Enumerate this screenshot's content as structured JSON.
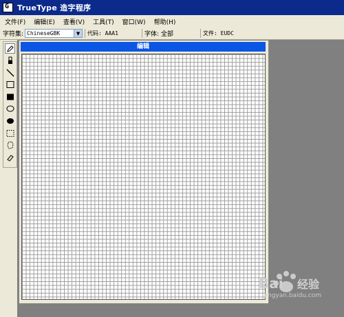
{
  "window": {
    "title": "TrueType 造字程序"
  },
  "menu": [
    {
      "label": "文件(F)"
    },
    {
      "label": "编辑(E)"
    },
    {
      "label": "查看(V)"
    },
    {
      "label": "工具(T)"
    },
    {
      "label": "窗口(W)"
    },
    {
      "label": "帮助(H)"
    }
  ],
  "toolbar": {
    "charset_label": "字符集:",
    "charset_value": "ChineseGBK",
    "code_label": "代码: AAA1",
    "font_label": "字体: 全部",
    "file_label": "文件: EUDC"
  },
  "tools": [
    {
      "name": "pencil-icon"
    },
    {
      "name": "brush-icon"
    },
    {
      "name": "line-icon"
    },
    {
      "name": "hollow-rectangle-icon"
    },
    {
      "name": "filled-rectangle-icon"
    },
    {
      "name": "hollow-ellipse-icon"
    },
    {
      "name": "filled-ellipse-icon"
    },
    {
      "name": "rectangular-select-icon"
    },
    {
      "name": "freeform-select-icon"
    },
    {
      "name": "eraser-icon"
    }
  ],
  "editor": {
    "title": "编辑"
  },
  "watermark": {
    "brand": "Bai 经验",
    "url": "jingyan.baidu.com"
  },
  "colors": {
    "title_bar": "#0b2a8c",
    "editor_title_bar": "#0b56e4",
    "window_face": "#ece9d8",
    "workspace": "#808080"
  }
}
